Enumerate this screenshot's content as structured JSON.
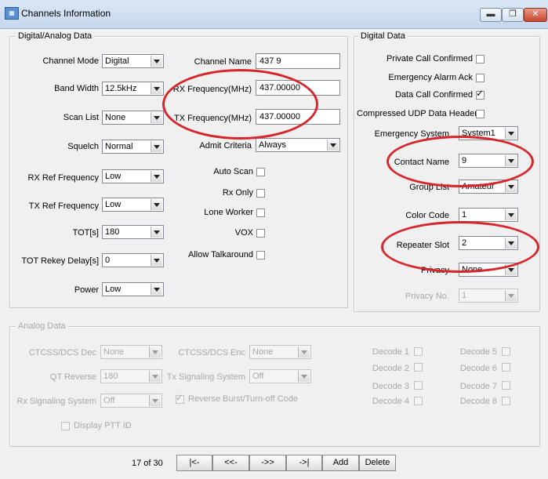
{
  "window": {
    "title": "Channels Information",
    "controls": {
      "minimize": "▬",
      "maximize": "❐",
      "close": "✕"
    }
  },
  "digital_analog": {
    "group_title": "Digital/Analog Data",
    "left": [
      {
        "label": "Channel Mode",
        "value": "Digital"
      },
      {
        "label": "Band Width",
        "value": "12.5kHz"
      },
      {
        "label": "Scan List",
        "value": "None"
      },
      {
        "label": "Squelch",
        "value": "Normal"
      },
      {
        "label": "RX Ref Frequency",
        "value": "Low"
      },
      {
        "label": "TX Ref Frequency",
        "value": "Low"
      },
      {
        "label": "TOT[s]",
        "value": "180"
      },
      {
        "label": "TOT Rekey Delay[s]",
        "value": "0"
      },
      {
        "label": "Power",
        "value": "Low"
      }
    ],
    "channel_name": {
      "label": "Channel Name",
      "value": "437 9"
    },
    "rx_frequency": {
      "label": "RX Frequency(MHz)",
      "value": "437.00000"
    },
    "tx_frequency": {
      "label": "TX Frequency(MHz)",
      "value": "437.00000"
    },
    "admit_criteria": {
      "label": "Admit Criteria",
      "value": "Always"
    },
    "checks": [
      {
        "label": "Auto Scan",
        "checked": false
      },
      {
        "label": "Rx Only",
        "checked": false
      },
      {
        "label": "Lone Worker",
        "checked": false
      },
      {
        "label": "VOX",
        "checked": false
      },
      {
        "label": "Allow Talkaround",
        "checked": false
      }
    ]
  },
  "digital": {
    "group_title": "Digital Data",
    "checks": [
      {
        "label": "Private Call Confirmed",
        "checked": false
      },
      {
        "label": "Emergency Alarm Ack",
        "checked": false
      },
      {
        "label": "Data Call Confirmed",
        "checked": true
      },
      {
        "label": "Compressed UDP Data Header",
        "checked": false
      }
    ],
    "selects": [
      {
        "label": "Emergency System",
        "value": "System1"
      },
      {
        "label": "Contact Name",
        "value": "9"
      },
      {
        "label": "Group List",
        "value": "Amateur"
      },
      {
        "label": "Color Code",
        "value": "1"
      },
      {
        "label": "Repeater Slot",
        "value": "2"
      },
      {
        "label": "Privacy",
        "value": "None"
      },
      {
        "label": "Privacy No.",
        "value": "1"
      }
    ]
  },
  "analog": {
    "group_title": "Analog Data",
    "ctcss_dec": {
      "label": "CTCSS/DCS Dec",
      "value": "None"
    },
    "ctcss_enc": {
      "label": "CTCSS/DCS Enc",
      "value": "None"
    },
    "qt_reverse": {
      "label": "QT Reverse",
      "value": "180"
    },
    "tx_signaling": {
      "label": "Tx Signaling System",
      "value": "Off"
    },
    "rx_signaling": {
      "label": "Rx Signaling System",
      "value": "Off"
    },
    "reverse_burst": {
      "label": "Reverse Burst/Turn-off Code",
      "checked": true
    },
    "display_ptt": {
      "label": "Display PTT ID",
      "checked": false
    },
    "decodes": [
      "Decode 1",
      "Decode 2",
      "Decode 3",
      "Decode 4",
      "Decode 5",
      "Decode 6",
      "Decode 7",
      "Decode 8"
    ]
  },
  "nav": {
    "position": "17 of 30",
    "first": "|<-",
    "prev": "<<-",
    "next": "->>",
    "last": "->|",
    "add": "Add",
    "delete": "Delete"
  },
  "annotation_color": "#d8252b"
}
